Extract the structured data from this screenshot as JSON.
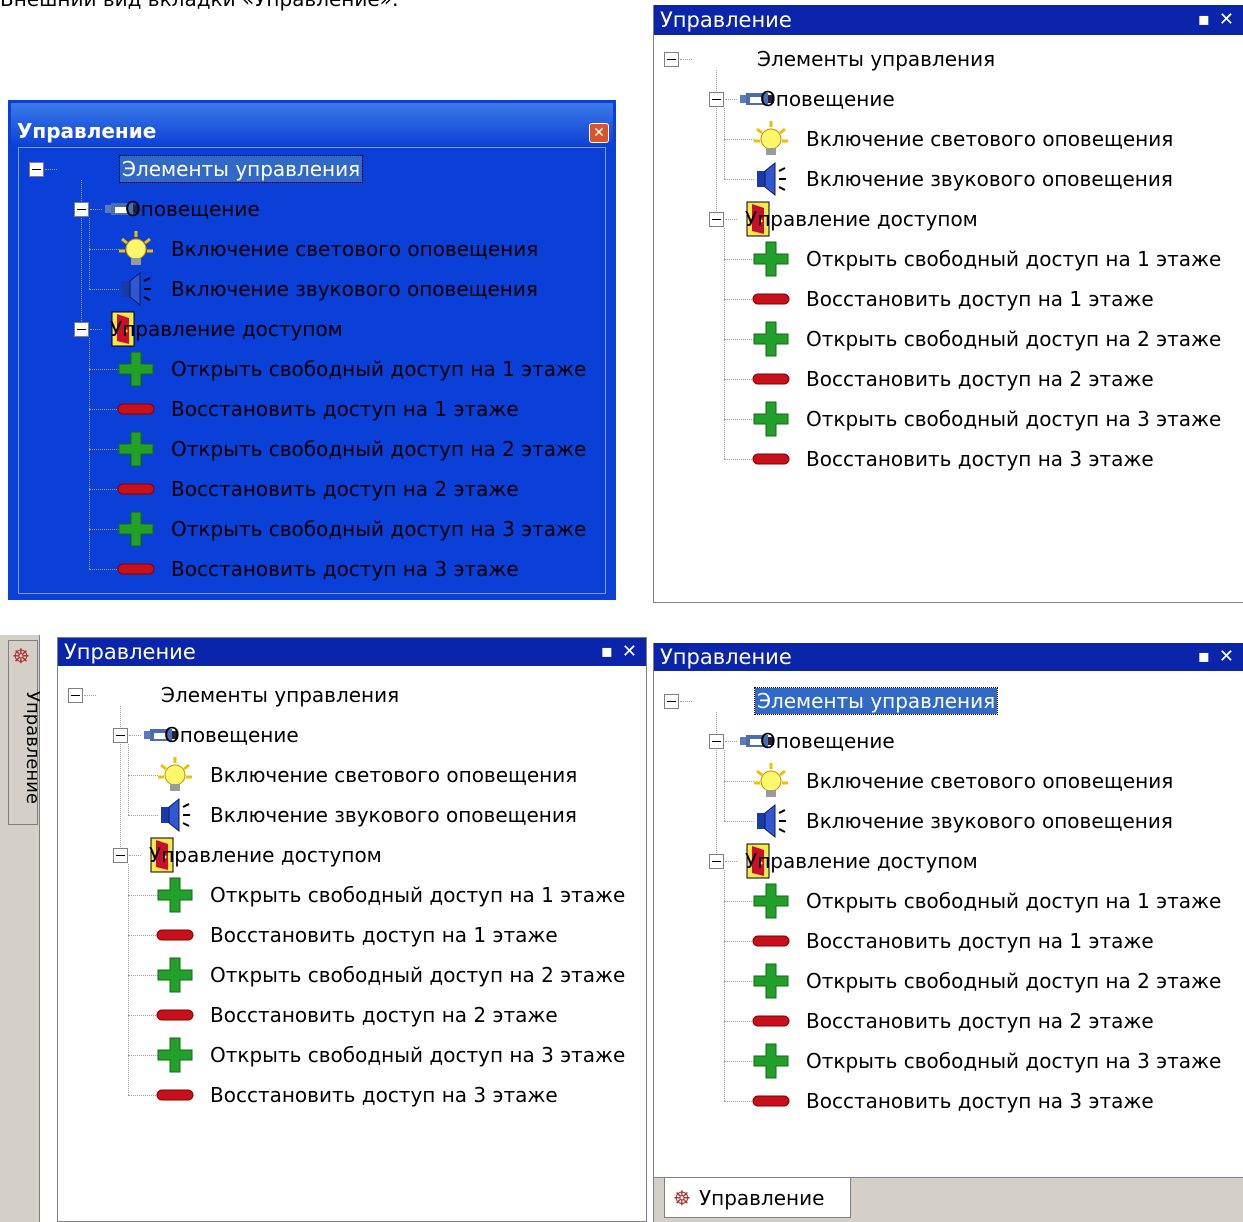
{
  "caption": "Внешний вид вкладки «Управление»:",
  "panel_title": "Управление",
  "tree": {
    "root": "Элементы управления",
    "alert_group": "Оповещение",
    "light_alert": "Включение светового оповещения",
    "sound_alert": "Включение звукового оповещения",
    "access_group": "Управление доступом",
    "open_1": "Открыть свободный доступ на 1 этаже",
    "restore_1": "Восстановить доступ на 1 этаже",
    "open_2": "Открыть свободный доступ на 2 этаже",
    "restore_2": "Восстановить доступ на 2 этаже",
    "open_3": "Открыть свободный доступ на 3 этаже",
    "restore_3": "Восстановить доступ на 3 этаже"
  },
  "side_tab_label": "Управление",
  "bottom_tab_label": "Управление",
  "title_buttons": {
    "pin": "⊕",
    "close": "✕"
  },
  "colors": {
    "xp_title": "#0a246a",
    "classic_title": "#0a24aa",
    "selection": "#3169c6"
  }
}
